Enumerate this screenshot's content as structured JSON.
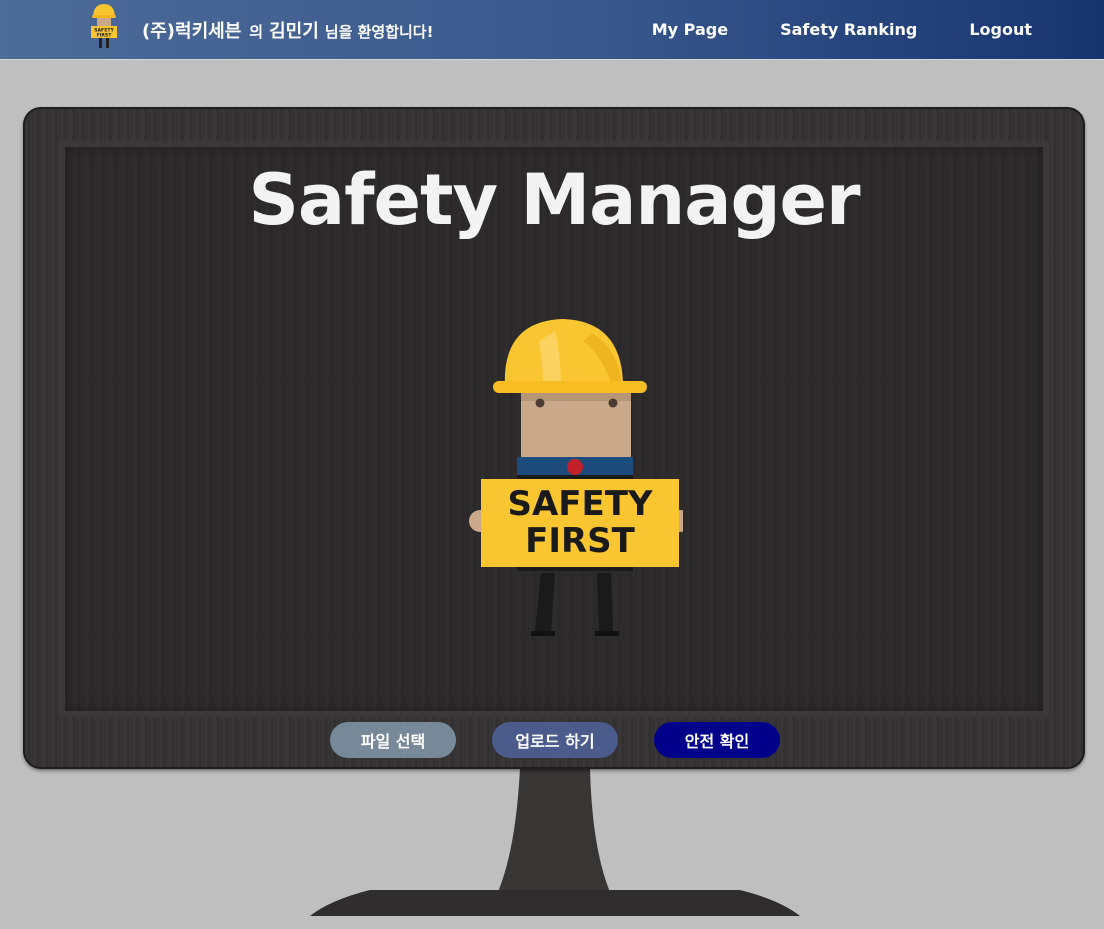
{
  "header": {
    "company": "(주)럭키세븐",
    "particle": "의",
    "username": "김민기",
    "greeting": "님을 환영합니다!",
    "logo_sign_text": "SAFETY FIRST",
    "nav": [
      {
        "label": "My Page"
      },
      {
        "label": "Safety Ranking"
      },
      {
        "label": "Logout"
      }
    ]
  },
  "main": {
    "title": "Safety Manager",
    "mascot_sign_line1": "SAFETY",
    "mascot_sign_line2": "FIRST",
    "buttons": [
      {
        "label": "파일 선택",
        "color": "#778899"
      },
      {
        "label": "업로드 하기",
        "color": "#4a5b8c"
      },
      {
        "label": "안전 확인",
        "color": "#00008b"
      }
    ]
  },
  "colors": {
    "navbar_start": "#4d6b98",
    "navbar_end": "#17346f",
    "page_background": "#bfbfbf",
    "helmet_yellow": "#f9c632"
  }
}
